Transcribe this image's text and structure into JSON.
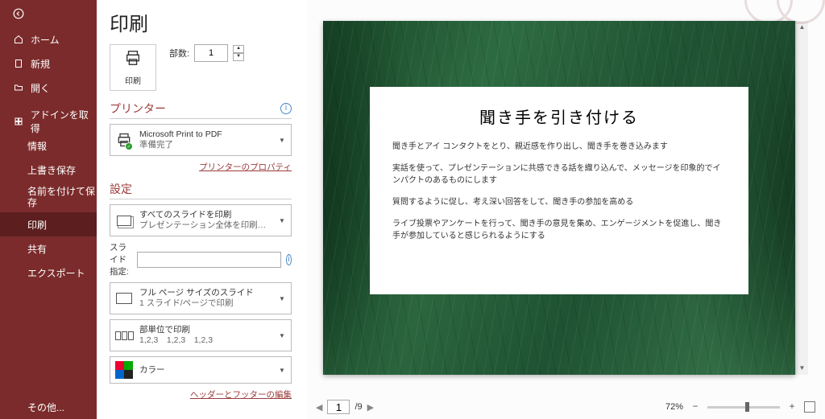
{
  "sidebar": {
    "items": [
      {
        "label": "ホーム",
        "name": "nav-home"
      },
      {
        "label": "新規",
        "name": "nav-new"
      },
      {
        "label": "開く",
        "name": "nav-open"
      },
      {
        "label": "アドインを取得",
        "name": "nav-addins"
      },
      {
        "label": "情報",
        "name": "nav-info"
      },
      {
        "label": "上書き保存",
        "name": "nav-save"
      },
      {
        "label": "名前を付けて保存",
        "name": "nav-saveas"
      },
      {
        "label": "印刷",
        "name": "nav-print"
      },
      {
        "label": "共有",
        "name": "nav-share"
      },
      {
        "label": "エクスポート",
        "name": "nav-export"
      },
      {
        "label": "その他...",
        "name": "nav-more"
      }
    ]
  },
  "panel": {
    "title": "印刷",
    "print_button_label": "印刷",
    "copies_label": "部数:",
    "copies_value": "1",
    "printer_section": "プリンター",
    "printer_name": "Microsoft Print to PDF",
    "printer_status": "準備完了",
    "printer_props": "プリンターのプロパティ",
    "settings_section": "設定",
    "dd_range_1": "すべてのスライドを印刷",
    "dd_range_2": "プレゼンテーション全体を印刷…",
    "slide_spec_label": "スライド指定:",
    "dd_layout_1": "フル ページ サイズのスライド",
    "dd_layout_2": "1 スライド/ページで印刷",
    "dd_collate_1": "部単位で印刷",
    "dd_collate_2": "1,2,3　1,2,3　1,2,3",
    "dd_color": "カラー",
    "header_footer_link": "ヘッダーとフッターの編集"
  },
  "preview": {
    "card_title": "聞き手を引き付ける",
    "p1": "聞き手とアイ コンタクトをとり、親近感を作り出し、聞き手を巻き込みます",
    "p2": "実話を使って、プレゼンテーションに共感できる話を織り込んで、メッセージを印象的でインパクトのあるものにします",
    "p3": "質問するように促し、考え深い回答をして、聞き手の参加を高める",
    "p4": "ライブ投票やアンケートを行って、聞き手の意見を集め、エンゲージメントを促進し、聞き手が参加していると感じられるようにする",
    "current_page": "1",
    "total_pages": "/9",
    "zoom": "72%"
  }
}
